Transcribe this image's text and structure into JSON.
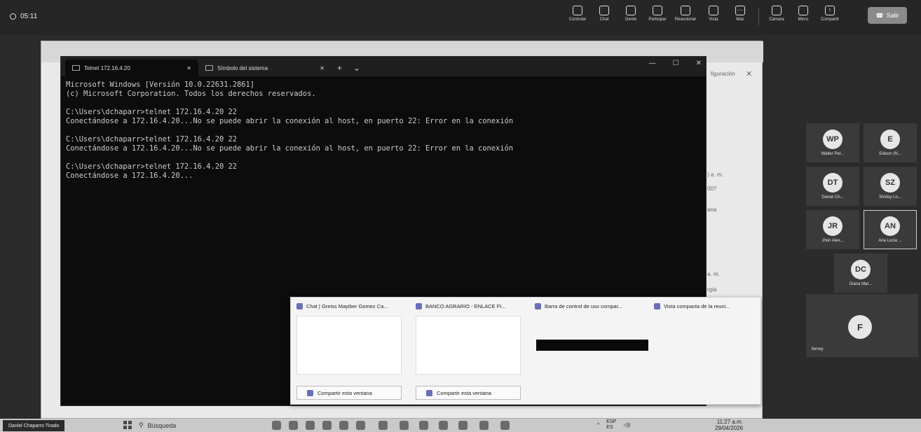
{
  "meeting": {
    "timer": "05:11",
    "tools": [
      {
        "label": "Controlar",
        "icon": "control-icon"
      },
      {
        "label": "Chat",
        "icon": "chat-icon"
      },
      {
        "label": "Gente",
        "icon": "people-icon"
      },
      {
        "label": "Participar",
        "icon": "raise-hand-icon"
      },
      {
        "label": "Reaccionar",
        "icon": "emoji-icon"
      },
      {
        "label": "Vista",
        "icon": "grid-icon"
      },
      {
        "label": "Más",
        "icon": "more-icon"
      },
      {
        "label": "Cámara",
        "icon": "camera-off-icon"
      },
      {
        "label": "Micro",
        "icon": "mic-off-icon"
      },
      {
        "label": "Compartir",
        "icon": "share-icon"
      }
    ],
    "leave_label": "Salir"
  },
  "behind": {
    "config_label": "figuración",
    "line1": ") a. m.",
    "line2": "00?",
    "line3": "ana",
    "line4": "a. m.",
    "line5": "rgia"
  },
  "terminal": {
    "tabs": [
      {
        "label": "Telnet 172.16.4.20"
      },
      {
        "label": "Símbolo del sistema"
      }
    ],
    "lines": [
      "Microsoft Windows [Versión 10.0.22631.2861]",
      "(c) Microsoft Corporation. Todos los derechos reservados.",
      "",
      "C:\\Users\\dchaparr>telnet 172.16.4.20 22",
      "Conectándose a 172.16.4.20...No se puede abrir la conexión al host, en puerto 22: Error en la conexión",
      "",
      "C:\\Users\\dchaparr>telnet 172.16.4.20 22",
      "Conectándose a 172.16.4.20...No se puede abrir la conexión al host, en puerto 22: Error en la conexión",
      "",
      "C:\\Users\\dchaparr>telnet 172.16.4.20 22",
      "Conectándose a 172.16.4.20..."
    ]
  },
  "participants": [
    {
      "initials": "WP",
      "name": "Walter Per..."
    },
    {
      "initials": "E",
      "name": "Edison (N..."
    },
    {
      "initials": "DT",
      "name": "Daniel Ch..."
    },
    {
      "initials": "SZ",
      "name": "Shirley Lo..."
    },
    {
      "initials": "JR",
      "name": "Jhon Alex..."
    },
    {
      "initials": "AN",
      "name": "Ana Lucia ..."
    },
    {
      "initials": "DC",
      "name": "Diana Mar..."
    },
    {
      "initials": "F",
      "name": "ferney"
    }
  ],
  "thumbnails": [
    {
      "title": "Chat | Greiss Mayiber Gomez Ca...",
      "share": "Compartir esta ventana"
    },
    {
      "title": "BANCO AGRARIO - ENLACE FI...",
      "share": "Compartir esta ventana"
    },
    {
      "title": "Barra de control de uso compar..."
    },
    {
      "title": "Vista compacta de la reuni..."
    }
  ],
  "taskbar": {
    "presenter": "Daniel Chaparro Tirado",
    "search_placeholder": "Búsqueda",
    "lang": "ESP",
    "lang_sub": "ES",
    "time": "11:27 a.m.",
    "date": "29/04/2026"
  },
  "colors": {
    "terminal_bg": "#0c0c0c",
    "terminal_text": "#cccccc",
    "meeting_bg": "#262626"
  }
}
